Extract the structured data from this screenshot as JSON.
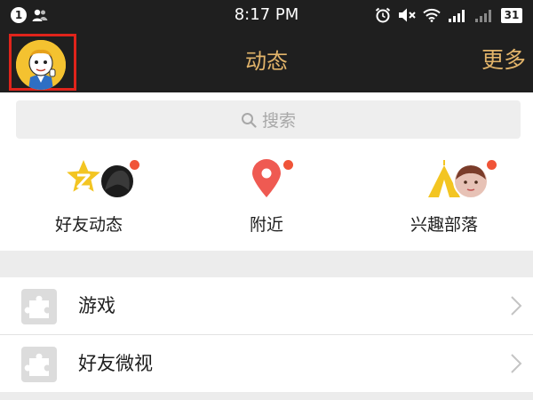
{
  "status_bar": {
    "notification_count": "1",
    "time": "8:17 PM",
    "battery_level": "31",
    "icons": [
      "contacts-icon",
      "alarm-icon",
      "mute-icon",
      "wifi-icon",
      "signal-icon",
      "signal-icon",
      "battery-icon"
    ]
  },
  "nav": {
    "title": "动态",
    "more": "更多"
  },
  "search": {
    "placeholder": "搜索"
  },
  "features": [
    {
      "label": "好友动态",
      "icon": "friends-feed-icon",
      "has_dot": true
    },
    {
      "label": "附近",
      "icon": "location-pin-icon",
      "has_dot": true
    },
    {
      "label": "兴趣部落",
      "icon": "tribe-tent-icon",
      "has_dot": true
    }
  ],
  "list": [
    {
      "label": "游戏",
      "icon": "puzzle-icon"
    },
    {
      "label": "好友微视",
      "icon": "puzzle-icon"
    }
  ],
  "colors": {
    "bar_bg": "#1f1f1f",
    "accent_gold": "#e2b46a",
    "badge_red": "#f05438",
    "star_yellow": "#f3c522",
    "pin_red": "#ef5a52"
  }
}
